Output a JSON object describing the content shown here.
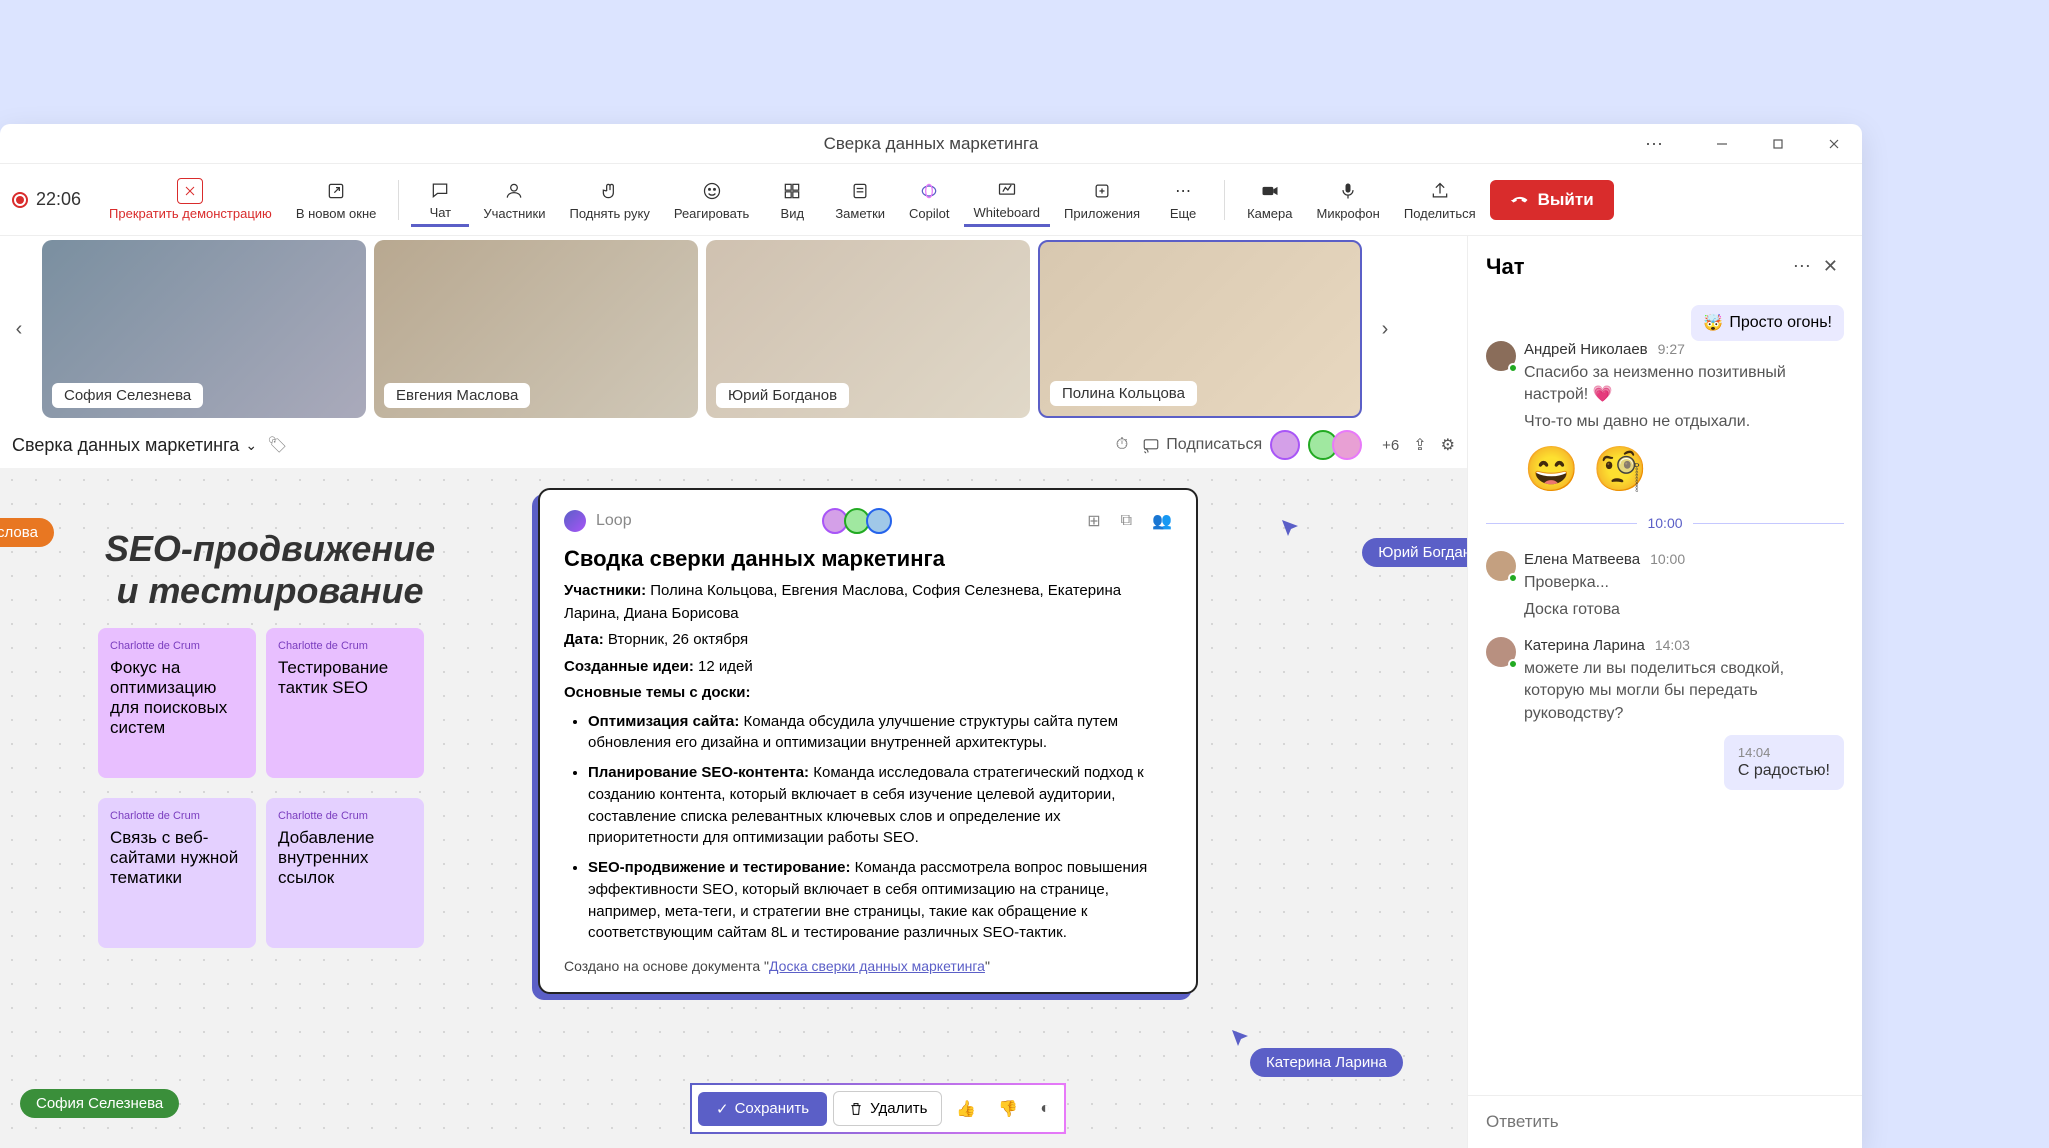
{
  "window": {
    "title": "Сверка данных маркетинга"
  },
  "recording": {
    "time": "22:06"
  },
  "toolbar": {
    "stop_share": "Прекратить демонстрацию",
    "new_window": "В новом окне",
    "chat": "Чат",
    "participants": "Участники",
    "raise_hand": "Поднять руку",
    "react": "Реагировать",
    "view": "Вид",
    "notes": "Заметки",
    "copilot": "Copilot",
    "whiteboard": "Whiteboard",
    "apps": "Приложения",
    "more": "Еще",
    "camera": "Камера",
    "mic": "Микрофон",
    "share": "Поделиться",
    "exit": "Выйти"
  },
  "videos": [
    {
      "name": "София Селезнева",
      "bg": "linear-gradient(135deg,#7a8fa0,#aab)"
    },
    {
      "name": "Евгения Маслова",
      "bg": "linear-gradient(135deg,#b8a890,#d0c8b8)"
    },
    {
      "name": "Юрий Богданов",
      "bg": "linear-gradient(135deg,#cfc1b0,#e0d8c8)"
    },
    {
      "name": "Полина Кольцова",
      "bg": "linear-gradient(135deg,#d8c8b0,#e8d8c0)",
      "active": true
    }
  ],
  "doc": {
    "title": "Сверка данных маркетинга",
    "subscribe": "Подписаться",
    "overflow": "+6"
  },
  "whiteboard": {
    "heading_line1": "SEO-продвижение",
    "heading_line2": "и тестирование",
    "pill_maslova": "Маслова",
    "notes": [
      {
        "header": "Charlotte de Crum",
        "text": "Фокус на оптимизацию для поисковых систем"
      },
      {
        "header": "Charlotte de Crum",
        "text": "Тестирование тактик SEO"
      },
      {
        "header": "Charlotte de Crum",
        "text": "Связь с веб-сайтами нужной тематики"
      },
      {
        "header": "Charlotte de Crum",
        "text": "Добавление внутренних ссылок"
      }
    ],
    "presence_yuri": "Юрий Богдан",
    "presence_katerina": "Катерина Ларина",
    "presence_sofia": "София Селезнева"
  },
  "loop": {
    "brand": "Loop",
    "title": "Сводка сверки данных маркетинга",
    "participants_label": "Участники:",
    "participants": "Полина Кольцова, Евгения Маслова, София Селезнева, Екатерина Ларина, Диана Борисова",
    "date_label": "Дата:",
    "date": "Вторник, 26 октября",
    "ideas_label": "Созданные идеи:",
    "ideas": "12 идей",
    "topics_label": "Основные темы с доски:",
    "topics": [
      {
        "t": "Оптимизация сайта:",
        "d": "Команда обсудила улучшение структуры сайта путем обновления его дизайна и оптимизации внутренней архитектуры."
      },
      {
        "t": "Планирование SEO-контента:",
        "d": "Команда исследовала стратегический подход к созданию контента, который включает в себя изучение целевой аудитории, составление списка релевантных ключевых слов и определение их приоритетности для оптимизации работы SEO."
      },
      {
        "t": "SEO-продвижение и тестирование:",
        "d": "Команда рассмотрела вопрос повышения эффективности SEO, который включает в себя оптимизацию на странице, например, мета-теги, и стратегии вне страницы, такие как обращение к соответствующим сайтам 8L и тестирование различных SEO-тактик."
      }
    ],
    "footer_prefix": "Создано на основе документа \"",
    "footer_link": "Доска сверки данных маркетинга",
    "footer_suffix": "\""
  },
  "confirm": {
    "save": "Сохранить",
    "delete": "Удалить"
  },
  "chat": {
    "title": "Чат",
    "reaction_text": "Просто огонь!",
    "messages": [
      {
        "author": "Андрей Николаев",
        "time": "9:27",
        "text": "Спасибо за неизменно позитивный настрой! 💗",
        "text2": "Что-то мы давно не отдыхали.",
        "emojis": true
      }
    ],
    "divider_time": "10:00",
    "later": [
      {
        "author": "Елена Матвеева",
        "time": "10:00",
        "text": "Проверка...",
        "text2": "Доска готова"
      },
      {
        "author": "Катерина Ларина",
        "time": "14:03",
        "text": "можете ли вы поделиться сводкой, которую мы могли бы передать руководству?"
      }
    ],
    "reply": {
      "time": "14:04",
      "text": "С радостью!"
    },
    "input_placeholder": "Ответить"
  }
}
